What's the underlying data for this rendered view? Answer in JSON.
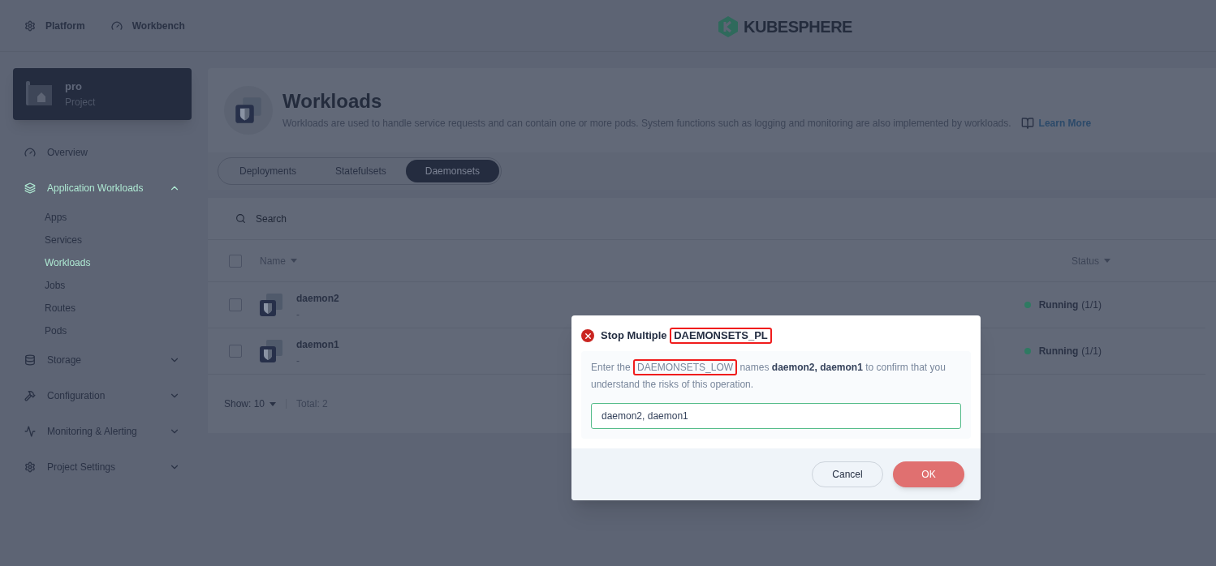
{
  "top_nav": [
    {
      "label": "Platform"
    },
    {
      "label": "Workbench"
    }
  ],
  "logo": {
    "text": "KUBESPHERE"
  },
  "project": {
    "name": "pro",
    "type": "Project"
  },
  "sidebar": [
    {
      "label": "Overview",
      "selected": false
    },
    {
      "label": "Application Workloads",
      "selected": true,
      "expanded": true,
      "children": [
        {
          "label": "Apps",
          "selected": false
        },
        {
          "label": "Services",
          "selected": false
        },
        {
          "label": "Workloads",
          "selected": true
        },
        {
          "label": "Jobs",
          "selected": false
        },
        {
          "label": "Routes",
          "selected": false
        },
        {
          "label": "Pods",
          "selected": false
        }
      ]
    },
    {
      "label": "Storage",
      "selected": false,
      "expanded": false
    },
    {
      "label": "Configuration",
      "selected": false,
      "expanded": false
    },
    {
      "label": "Monitoring & Alerting",
      "selected": false,
      "expanded": false
    },
    {
      "label": "Project Settings",
      "selected": false,
      "expanded": false
    }
  ],
  "page_header": {
    "title": "Workloads",
    "description": "Workloads are used to handle service requests and can contain one or more pods. System functions such as logging and monitoring are also implemented by workloads.",
    "learn_more": "Learn More"
  },
  "tabs": [
    {
      "label": "Deployments",
      "selected": false
    },
    {
      "label": "Statefulsets",
      "selected": false
    },
    {
      "label": "Daemonsets",
      "selected": true
    }
  ],
  "search": {
    "placeholder": "Search"
  },
  "table": {
    "columns": [
      "Name",
      "Status"
    ],
    "all_checked": false,
    "rows": [
      {
        "name": "daemon2",
        "description": "-",
        "status": "Running",
        "count": "(1/1)",
        "color": "#2f7a62",
        "checked": false
      },
      {
        "name": "daemon1",
        "description": "-",
        "status": "Running",
        "count": "(1/1)",
        "color": "#2f7a62",
        "checked": false
      }
    ],
    "page_size": "Show: 10",
    "total": "Total: 2"
  },
  "dialog": {
    "title": [
      {
        "text": "Stop Multiple",
        "kind": "plain"
      },
      {
        "text": "DAEMONSETS_PL",
        "kind": "highlight"
      }
    ],
    "message": [
      {
        "text": "Enter the",
        "kind": "plain"
      },
      {
        "text": "DAEMONSETS_LOW",
        "kind": "highlight"
      },
      {
        "text": "names",
        "kind": "plain"
      },
      {
        "text": "daemon2, daemon1",
        "kind": "bold"
      },
      {
        "text": "to confirm that you understand the risks of this operation.",
        "kind": "plain"
      }
    ],
    "input_value": "daemon2, daemon1",
    "buttons": [
      {
        "label": "Cancel",
        "kind": "secondary"
      },
      {
        "label": "OK",
        "kind": "danger"
      }
    ]
  }
}
